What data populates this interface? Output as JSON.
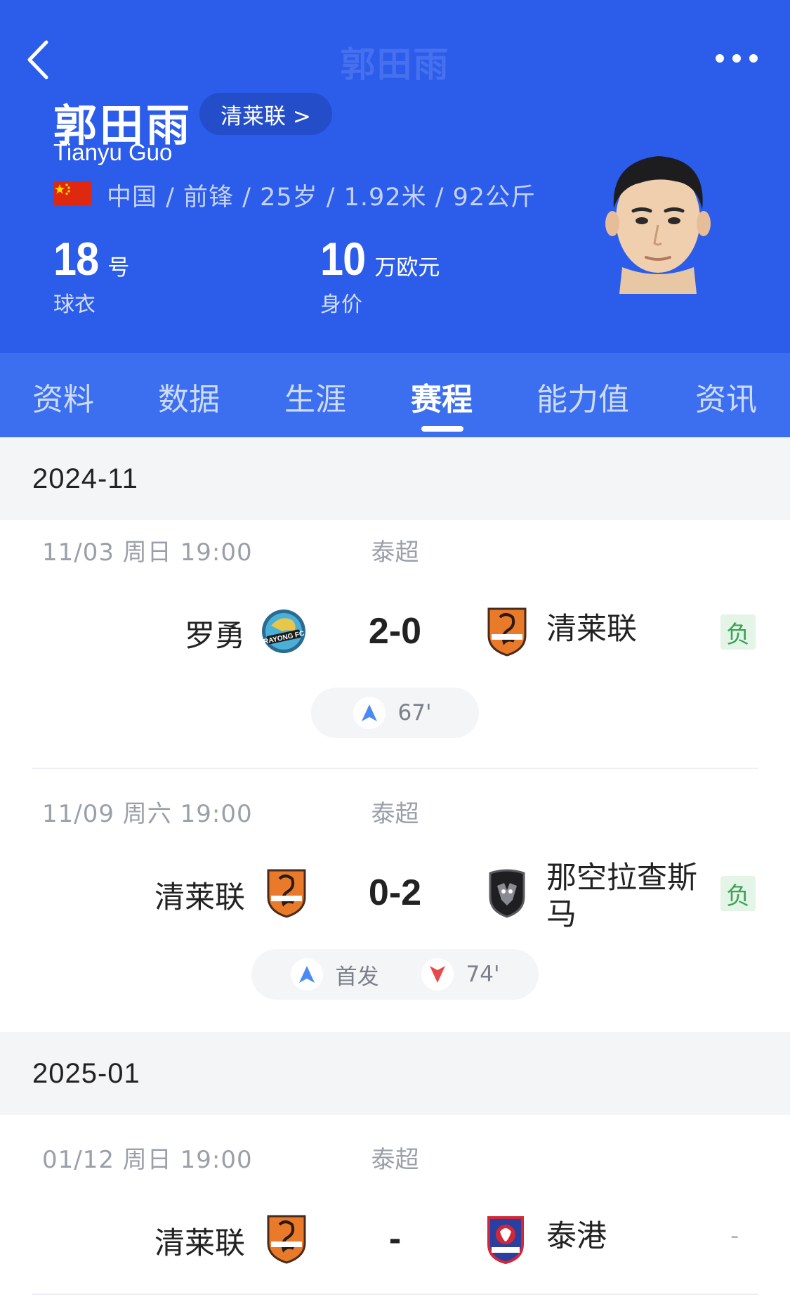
{
  "header": {
    "nav_title": "郭田雨",
    "player_name": "郭田雨",
    "team_link": "清莱联 >",
    "player_name_en": "Tianyu Guo",
    "info_line": "中国 / 前锋 / 25岁 / 1.92米 / 92公斤",
    "shirt_number": "18",
    "shirt_unit": "号",
    "shirt_label": "球衣",
    "market_value": "10",
    "market_value_unit": "万欧元",
    "market_value_label": "身价"
  },
  "tabs": [
    {
      "label": "资料"
    },
    {
      "label": "数据"
    },
    {
      "label": "生涯"
    },
    {
      "label": "赛程",
      "active": true
    },
    {
      "label": "能力值"
    },
    {
      "label": "资讯"
    }
  ],
  "colors": {
    "header_bg": "#2b5cea",
    "tab_bg": "#3b6ff0",
    "sub_in": "#4a8af4",
    "sub_out": "#e84a4a",
    "loss_badge": "#3aa356"
  },
  "sections": [
    {
      "month": "2024-11",
      "matches": [
        {
          "date": "11/03  周日 19:00",
          "league": "泰超",
          "home": "罗勇",
          "home_logo": "rayong-fc-logo",
          "score": "2-0",
          "away": "清莱联",
          "away_logo": "chiangrai-united-logo",
          "result": "负",
          "events": [
            {
              "icon": "sub-in-icon",
              "text": "67'"
            }
          ]
        },
        {
          "date": "11/09  周六 19:00",
          "league": "泰超",
          "home": "清莱联",
          "home_logo": "chiangrai-united-logo",
          "score": "0-2",
          "away_line1": "那空拉查斯",
          "away_line2": "马",
          "away_logo": "nakhon-ratchasima-logo",
          "result": "负",
          "events": [
            {
              "icon": "sub-in-icon",
              "text": "首发"
            },
            {
              "icon": "sub-out-icon",
              "text": "74'"
            }
          ]
        }
      ]
    },
    {
      "month": "2025-01",
      "matches": [
        {
          "date": "01/12  周日 19:00",
          "league": "泰超",
          "home": "清莱联",
          "home_logo": "chiangrai-united-logo",
          "score": "-",
          "away": "泰港",
          "away_logo": "port-fc-logo",
          "result": "-"
        }
      ]
    }
  ]
}
